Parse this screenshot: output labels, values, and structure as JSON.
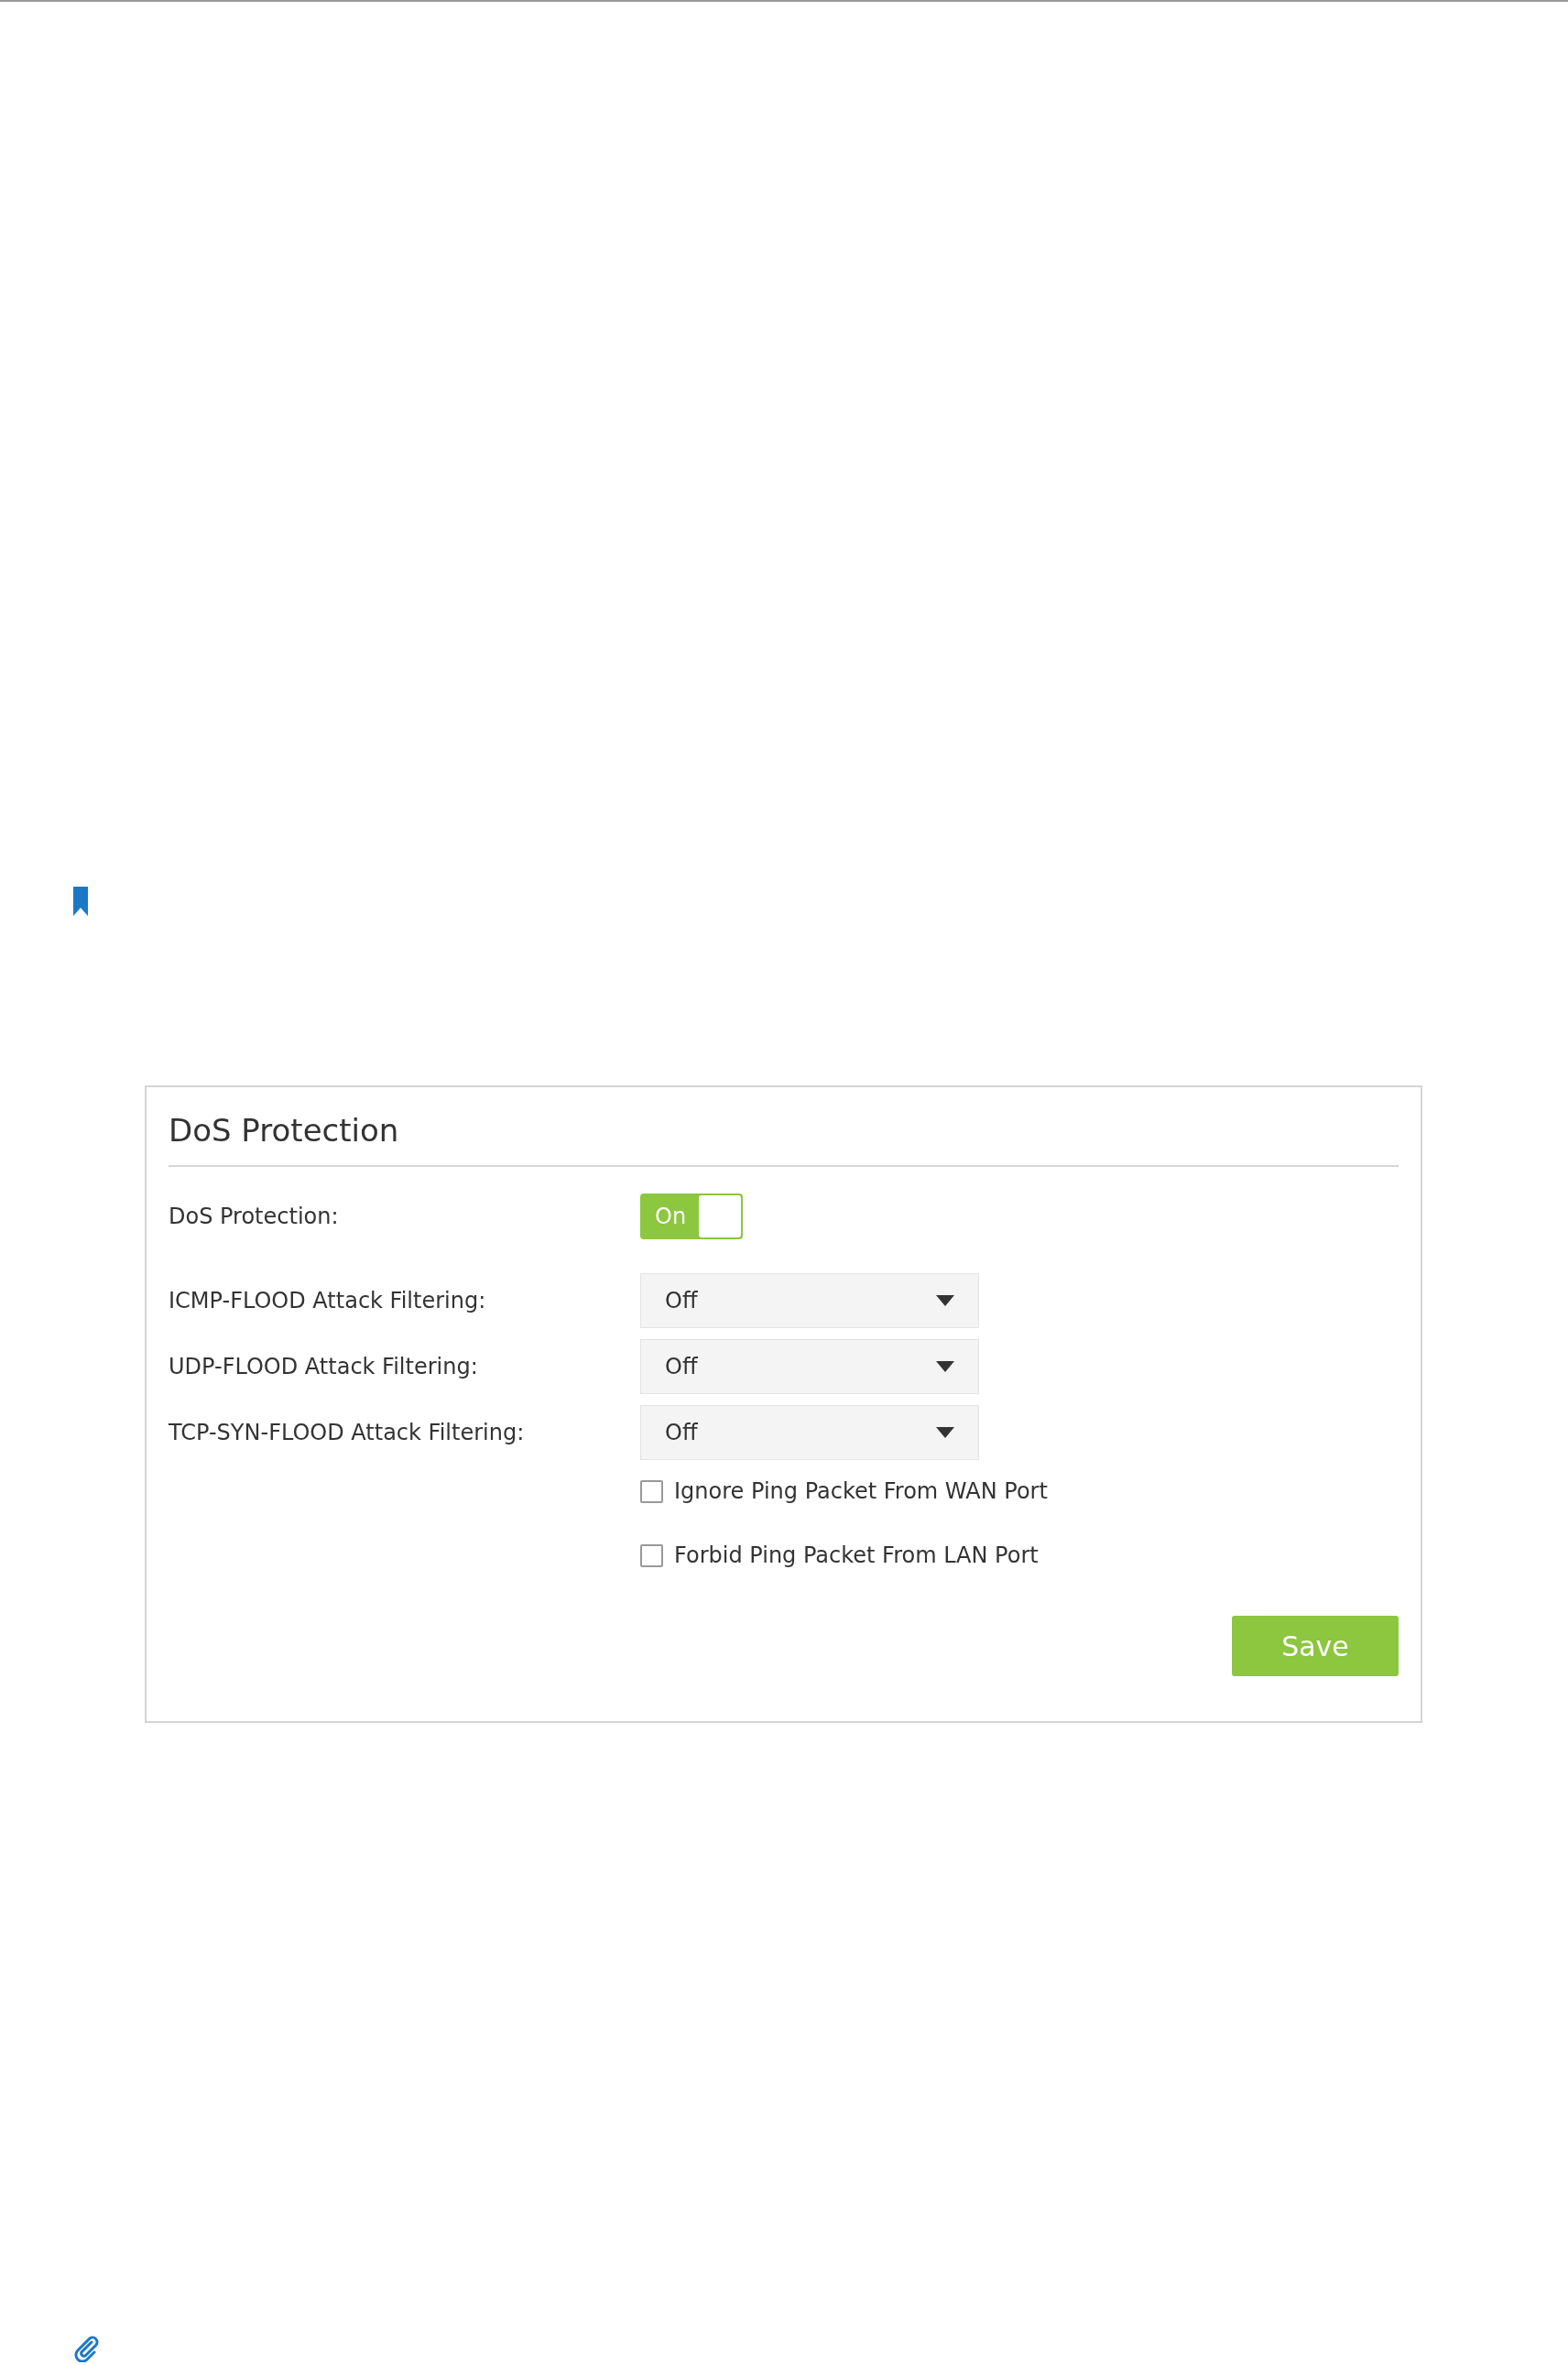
{
  "panel": {
    "title": "DoS Protection",
    "fields": [
      {
        "kind": "toggle",
        "label": "DoS Protection:",
        "on": true,
        "text": "On"
      },
      {
        "kind": "select",
        "label": "ICMP-FLOOD Attack Filtering:",
        "value": "Off"
      },
      {
        "kind": "select",
        "label": "UDP-FLOOD Attack Filtering:",
        "value": "Off"
      },
      {
        "kind": "select",
        "label": "TCP-SYN-FLOOD Attack Filtering:",
        "value": "Off"
      },
      {
        "kind": "checkbox",
        "label": "Ignore Ping Packet From WAN Port",
        "checked": false
      },
      {
        "kind": "checkbox",
        "label": "Forbid Ping Packet From LAN Port",
        "checked": false
      }
    ],
    "save_button": "Save"
  }
}
